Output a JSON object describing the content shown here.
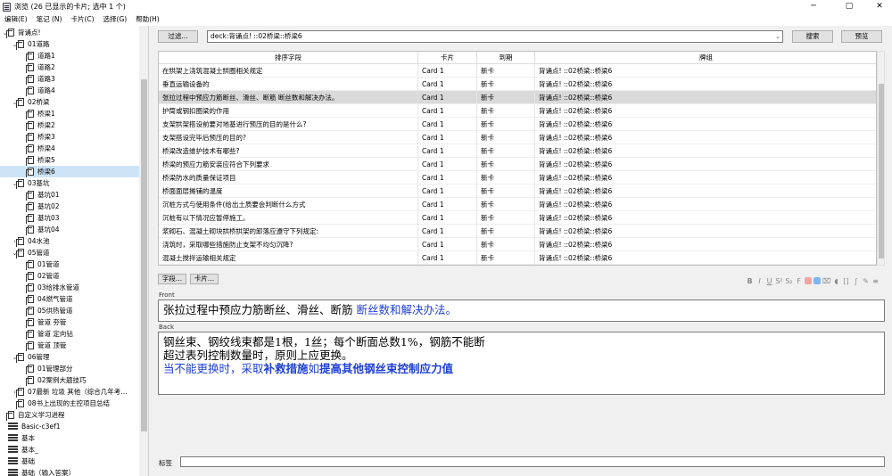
{
  "window": {
    "title": "浏览 (26 已显示的卡片; 选中 1 个)",
    "min": "─",
    "max": "▢",
    "close": "✕"
  },
  "menu": [
    "编辑(E)",
    "笔记 (N)",
    "卡片(C)",
    "选择(G)",
    "帮助(H)"
  ],
  "sidebar": {
    "items": [
      {
        "label": "背诵点!",
        "indent": 0,
        "arrow": "down",
        "icon": "deck-icon"
      },
      {
        "label": "01道路",
        "indent": 1,
        "arrow": "down",
        "icon": "deck-icon"
      },
      {
        "label": "道路1",
        "indent": 2,
        "arrow": "",
        "icon": "deck-icon"
      },
      {
        "label": "道路2",
        "indent": 2,
        "arrow": "",
        "icon": "deck-icon"
      },
      {
        "label": "道路3",
        "indent": 2,
        "arrow": "",
        "icon": "deck-icon"
      },
      {
        "label": "道路4",
        "indent": 2,
        "arrow": "",
        "icon": "deck-icon"
      },
      {
        "label": "02桥梁",
        "indent": 1,
        "arrow": "down",
        "icon": "deck-icon"
      },
      {
        "label": "桥梁1",
        "indent": 2,
        "arrow": "",
        "icon": "deck-icon"
      },
      {
        "label": "桥梁2",
        "indent": 2,
        "arrow": "",
        "icon": "deck-icon"
      },
      {
        "label": "桥梁3",
        "indent": 2,
        "arrow": "",
        "icon": "deck-icon"
      },
      {
        "label": "桥梁4",
        "indent": 2,
        "arrow": "",
        "icon": "deck-icon"
      },
      {
        "label": "桥梁5",
        "indent": 2,
        "arrow": "",
        "icon": "deck-icon"
      },
      {
        "label": "桥梁6",
        "indent": 2,
        "arrow": "",
        "icon": "deck-icon",
        "selected": true
      },
      {
        "label": "03基坑",
        "indent": 1,
        "arrow": "down",
        "icon": "deck-icon"
      },
      {
        "label": "基坑01",
        "indent": 2,
        "arrow": "",
        "icon": "deck-icon"
      },
      {
        "label": "基坑02",
        "indent": 2,
        "arrow": "",
        "icon": "deck-icon"
      },
      {
        "label": "基坑03",
        "indent": 2,
        "arrow": "",
        "icon": "deck-icon"
      },
      {
        "label": "基坑04",
        "indent": 2,
        "arrow": "",
        "icon": "deck-icon"
      },
      {
        "label": "04水池",
        "indent": 1,
        "arrow": "right",
        "icon": "deck-icon"
      },
      {
        "label": "05管道",
        "indent": 1,
        "arrow": "down",
        "icon": "deck-icon"
      },
      {
        "label": "01管道",
        "indent": 2,
        "arrow": "",
        "icon": "deck-icon"
      },
      {
        "label": "02管道",
        "indent": 2,
        "arrow": "",
        "icon": "deck-icon"
      },
      {
        "label": "03给排水管道",
        "indent": 2,
        "arrow": "",
        "icon": "deck-icon"
      },
      {
        "label": "04燃气管道",
        "indent": 2,
        "arrow": "",
        "icon": "deck-icon"
      },
      {
        "label": "05供热管道",
        "indent": 2,
        "arrow": "",
        "icon": "deck-icon"
      },
      {
        "label": "管道 夯管",
        "indent": 2,
        "arrow": "",
        "icon": "deck-icon"
      },
      {
        "label": "管道 定向钻",
        "indent": 2,
        "arrow": "",
        "icon": "deck-icon"
      },
      {
        "label": "管道 顶管",
        "indent": 2,
        "arrow": "",
        "icon": "deck-icon"
      },
      {
        "label": "06管理",
        "indent": 1,
        "arrow": "down",
        "icon": "deck-icon"
      },
      {
        "label": "01管理部分",
        "indent": 2,
        "arrow": "",
        "icon": "deck-icon"
      },
      {
        "label": "02案例大题技巧",
        "indent": 2,
        "arrow": "",
        "icon": "deck-icon"
      },
      {
        "label": "07最新 垃圾 其他（综合几年考...",
        "indent": 1,
        "arrow": "right",
        "icon": "deck-icon"
      },
      {
        "label": "08书上出现的主控项目总结",
        "indent": 1,
        "arrow": "",
        "icon": "deck-icon"
      },
      {
        "label": "自定义学习进程",
        "indent": 0,
        "arrow": "",
        "icon": "deck-icon"
      },
      {
        "label": "Basic-c3ef1",
        "indent": 0,
        "arrow": "",
        "icon": "note-icon"
      },
      {
        "label": "基本",
        "indent": 0,
        "arrow": "",
        "icon": "note-icon"
      },
      {
        "label": "基本_",
        "indent": 0,
        "arrow": "",
        "icon": "note-icon"
      },
      {
        "label": "基础",
        "indent": 0,
        "arrow": "",
        "icon": "note-icon"
      },
      {
        "label": "基础（输入答案）",
        "indent": 0,
        "arrow": "",
        "icon": "note-icon"
      }
    ]
  },
  "toolbar": {
    "filter_label": "过滤...",
    "search_value": "deck:背诵点! ::02桥梁::桥梁6",
    "search_button": "搜索",
    "preview_button": "预览"
  },
  "table": {
    "headers": [
      "排序字段",
      "卡片",
      "到期",
      "牌组"
    ],
    "rows": [
      {
        "field": "在拱架上浇筑混凝土拱圈相关规定",
        "card": "Card 1",
        "due": "新卡",
        "deck": "背诵点! ::02桥梁::桥梁6"
      },
      {
        "field": "垂直运输设备的",
        "card": "Card 1",
        "due": "新卡",
        "deck": "背诵点! ::02桥梁::桥梁6"
      },
      {
        "field": "张拉过程中预应力筋断丝、滑丝、断筋 断丝数和解决办法。",
        "card": "Card 1",
        "due": "新卡",
        "deck": "背诵点! ::02桥梁::桥梁6",
        "selected": true
      },
      {
        "field": "护筒或钢扣圈梁的作用",
        "card": "Card 1",
        "due": "新卡",
        "deck": "背诵点! ::02桥梁::桥梁6"
      },
      {
        "field": "支架拱架搭设前要对地基进行预压的目的是什么?",
        "card": "Card 1",
        "due": "新卡",
        "deck": "背诵点! ::02桥梁::桥梁6"
      },
      {
        "field": "支架搭设完毕后预压的目的?",
        "card": "Card 1",
        "due": "新卡",
        "deck": "背诵点! ::02桥梁::桥梁6"
      },
      {
        "field": "桥梁改造维护技术有哪些?",
        "card": "Card 1",
        "due": "新卡",
        "deck": "背诵点! ::02桥梁::桥梁6"
      },
      {
        "field": "桥梁的预应力筋安装应符合下列要求",
        "card": "Card 1",
        "due": "新卡",
        "deck": "背诵点! ::02桥梁::桥梁6"
      },
      {
        "field": "桥梁防水的质量保证项目",
        "card": "Card 1",
        "due": "新卡",
        "deck": "背诵点! ::02桥梁::桥梁6"
      },
      {
        "field": "桥面面层摊铺的温度",
        "card": "Card 1",
        "due": "新卡",
        "deck": "背诵点! ::02桥梁::桥梁6"
      },
      {
        "field": "沉桩方式与使用条件(给出土质要会判断什么方式",
        "card": "Card 1",
        "due": "新卡",
        "deck": "背诵点! ::02桥梁::桥梁6"
      },
      {
        "field": "沉桩有以下情况应暂停施工。",
        "card": "Card 1",
        "due": "新卡",
        "deck": "背诵点! ::02桥梁::桥梁6"
      },
      {
        "field": "浆砌石、混凝土砌块拱桥拱架的卸落应遵守下列规定:",
        "card": "Card 1",
        "due": "新卡",
        "deck": "背诵点! ::02桥梁::桥梁6"
      },
      {
        "field": "浇筑时，采取哪些措施防止支架不均匀沉降?",
        "card": "Card 1",
        "due": "新卡",
        "deck": "背诵点! ::02桥梁::桥梁6"
      },
      {
        "field": "混凝土搅拌运输相关规定",
        "card": "Card 1",
        "due": "新卡",
        "deck": "背诵点! ::02桥梁::桥梁6"
      },
      {
        "field": "混凝土施工前应做好哪些准备工作?",
        "card": "Card 1",
        "due": "新卡",
        "deck": "背诵点! ::02桥梁::桥梁6"
      }
    ]
  },
  "editor": {
    "fields_button": "字段...",
    "cards_button": "卡片...",
    "front_label": "Front",
    "front_plain": "张拉过程中预应力筋断丝、滑丝、断筋 ",
    "front_blue": "断丝数和解决办法。",
    "back_label": "Back",
    "back_line1": "钢丝束、钢绞线束都是1根，1丝；每个断面总数1%，钢筋不能断",
    "back_line2": "超过表列控制数量时，原则上应更换。",
    "back_line3a": "当不能更换时，采取",
    "back_line3b": "补救措施",
    "back_line3c": "如",
    "back_line3d": "提高其他钢丝束控制应力值",
    "tags_label": "标签",
    "tags_value": ""
  },
  "format_toolbar": {
    "bold": "B",
    "italic": "I",
    "underline": "U",
    "superscript": "S²",
    "subscript": "S₂",
    "clear": "F",
    "text_color": "#f3a3a3",
    "highlight_color": "#7fb7f0"
  }
}
